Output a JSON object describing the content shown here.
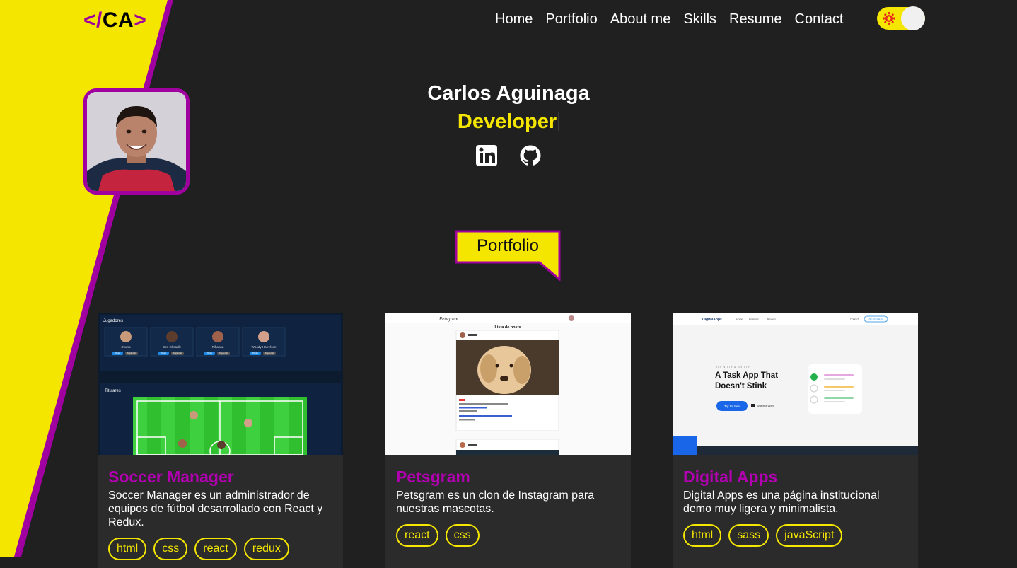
{
  "logo": {
    "open": "</",
    "letters": "CA",
    "close": ">"
  },
  "nav": [
    "Home",
    "Portfolio",
    "About me",
    "Skills",
    "Resume",
    "Contact"
  ],
  "theme_toggle": {
    "state": "light",
    "icon": "sun-icon"
  },
  "hero": {
    "name": "Carlos Aguinaga",
    "role": "Developer"
  },
  "socials": [
    {
      "icon": "linkedin-icon"
    },
    {
      "icon": "github-icon"
    }
  ],
  "section": {
    "title": "Portfolio"
  },
  "projects": [
    {
      "title": "Soccer Manager",
      "description": "Soccer Manager es un administrador de equipos de fútbol desarrollado con React y Redux.",
      "tags": [
        "html",
        "css",
        "react",
        "redux"
      ],
      "preview": {
        "players_header": "Jugadores",
        "starters_header": "Titulares",
        "players": [
          "Dcuna",
          "Don Cheadle",
          "Rihanna",
          "Woody Harrelson"
        ],
        "action_labels": [
          "Titular",
          "Suplente"
        ]
      }
    },
    {
      "title": "Petsgram",
      "description": "Petsgram es un clon de Instagram para nuestras mascotas.",
      "tags": [
        "react",
        "css"
      ],
      "preview": {
        "brand": "Petsgram",
        "heading": "Lista de posts"
      }
    },
    {
      "title": "Digital Apps",
      "description": "Digital Apps es una página institucional demo muy ligera y minimalista.",
      "tags": [
        "html",
        "sass",
        "javaScript"
      ],
      "preview": {
        "brand": "DigitalApps",
        "nav": [
          "Home",
          "Features",
          "Review"
        ],
        "contact": "Contact",
        "premium": "Go Premium",
        "kicker": "ITS NITTY & GRITTY",
        "headline": "A Task App That Doesn't Stink",
        "cta": "Try for free",
        "video": "Watch a video"
      }
    }
  ],
  "colors": {
    "accent_yellow": "#f5e600",
    "accent_purple": "#a0009f",
    "background": "#202020",
    "card": "#2b2b2b"
  }
}
